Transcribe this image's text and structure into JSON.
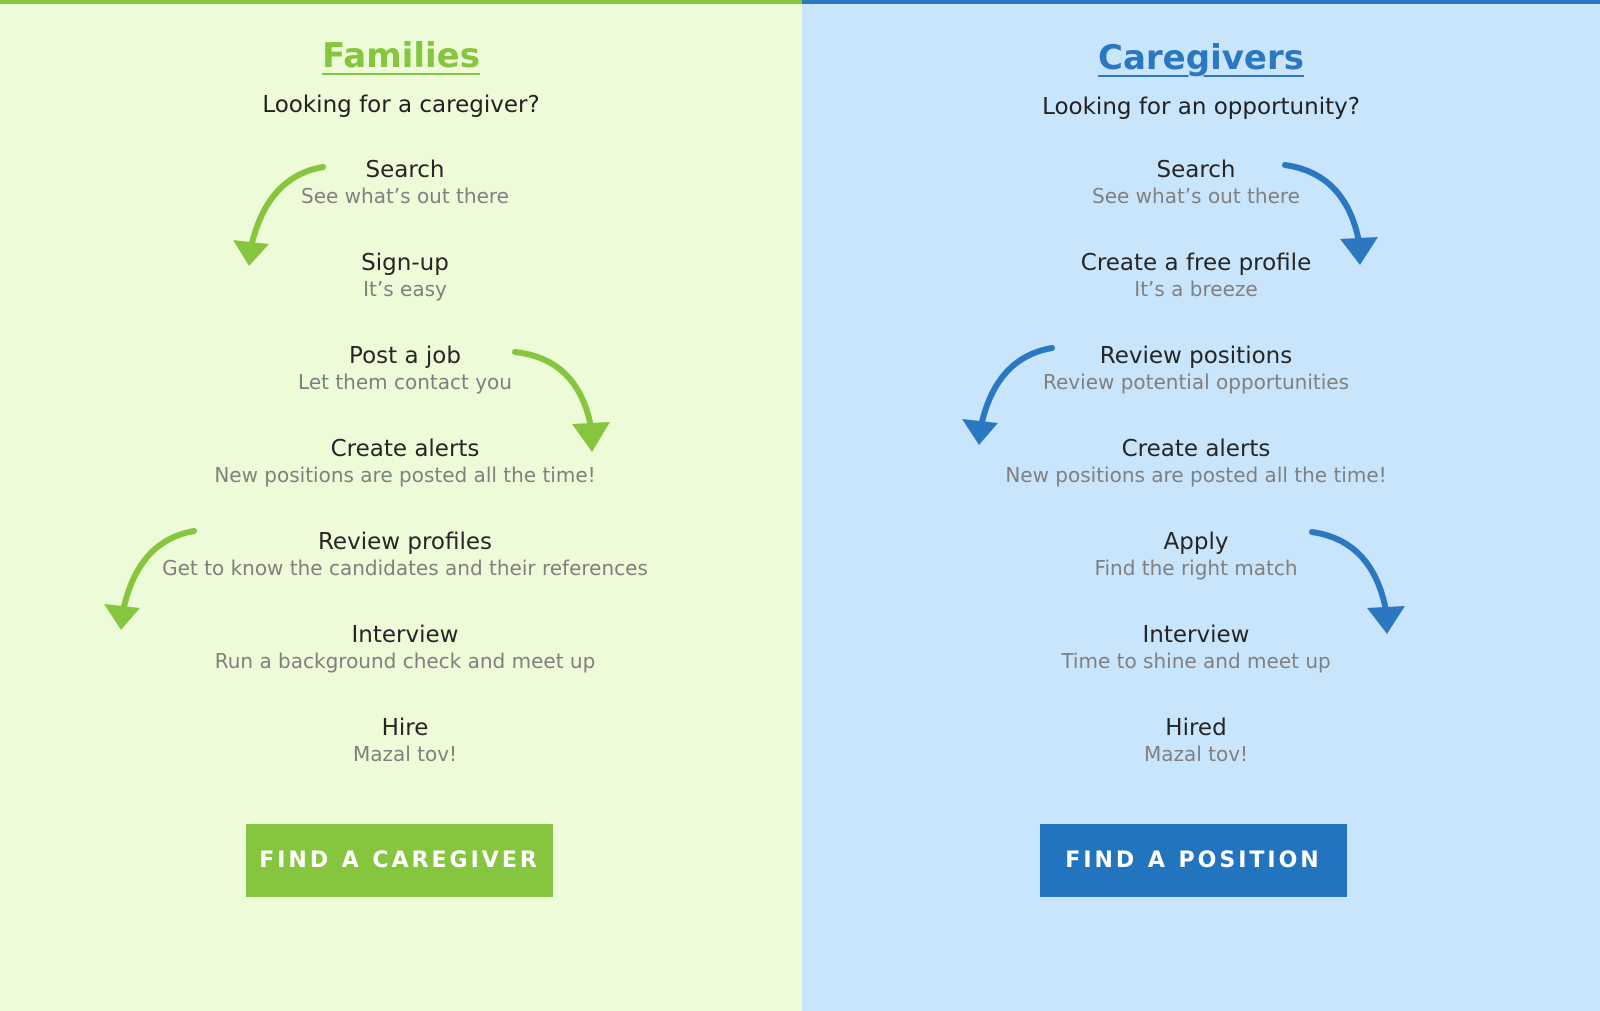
{
  "colors": {
    "green": "#86c63e",
    "blue": "#2b78c0",
    "green_bg": "#edfbd8",
    "blue_bg": "#c8e5fc"
  },
  "families": {
    "title": "Families",
    "subtitle": "Looking for a caregiver?",
    "steps": [
      {
        "title": "Search",
        "sub": "See what’s out there"
      },
      {
        "title": "Sign-up",
        "sub": "It’s easy"
      },
      {
        "title": "Post a job",
        "sub": "Let them contact you"
      },
      {
        "title": "Create alerts",
        "sub": "New positions are posted all the time!"
      },
      {
        "title": "Review profiles",
        "sub": "Get to know the candidates and their references"
      },
      {
        "title": "Interview",
        "sub": "Run a background check and meet up"
      },
      {
        "title": "Hire",
        "sub": "Mazal tov!"
      }
    ],
    "button_label": "FIND A CAREGIVER",
    "arrow_icon": "curved-arrow-icon"
  },
  "caregivers": {
    "title": "Caregivers",
    "subtitle": "Looking for an opportunity?",
    "steps": [
      {
        "title": "Search",
        "sub": "See what’s out there"
      },
      {
        "title": "Create a free profile",
        "sub": "It’s a breeze"
      },
      {
        "title": "Review positions",
        "sub": "Review potential opportunities"
      },
      {
        "title": "Create alerts",
        "sub": "New positions are posted all the time!"
      },
      {
        "title": "Apply",
        "sub": "Find the right match"
      },
      {
        "title": "Interview",
        "sub": "Time to shine and meet up"
      },
      {
        "title": "Hired",
        "sub": "Mazal tov!"
      }
    ],
    "button_label": "FIND A POSITION",
    "arrow_icon": "curved-arrow-icon"
  }
}
